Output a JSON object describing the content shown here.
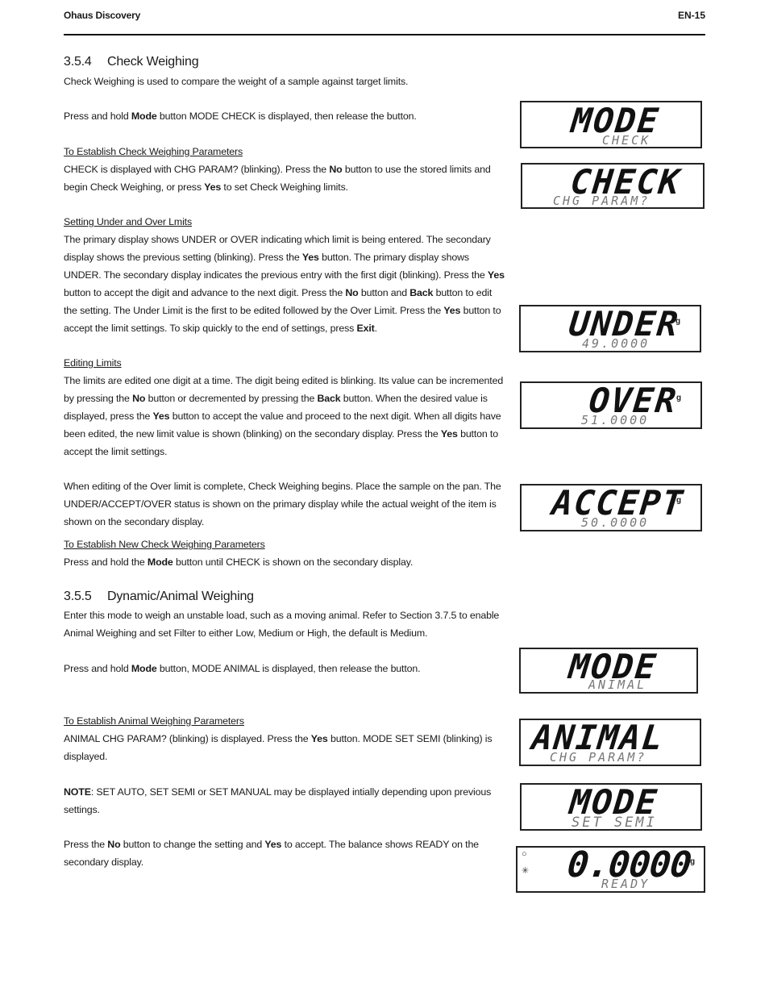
{
  "header": {
    "left": "Ohaus Discovery",
    "right": "EN-15"
  },
  "section_354": {
    "number": "3.5.4",
    "title": "Check Weighing",
    "intro": [
      {
        "t": "Check Weighing is used to compare the weight of a sample against target limits."
      }
    ],
    "press_mode": [
      {
        "t": "Press and hold "
      },
      {
        "t": "Mode",
        "b": true
      },
      {
        "t": " button MODE CHECK is displayed, then release the button."
      }
    ],
    "establish_title": "To Establish Check Weighing Parameters",
    "establish_body": [
      {
        "t": "CHECK is displayed with CHG PARAM? (blinking).  Press the "
      },
      {
        "t": "No",
        "b": true
      },
      {
        "t": " button to use the stored limits and begin Check Weighing, or press "
      },
      {
        "t": "Yes",
        "b": true
      },
      {
        "t": " to set Check Weighing limits."
      }
    ],
    "limits_title": "Setting Under and Over Lmits",
    "limits_body": [
      {
        "t": "The primary display shows UNDER or OVER indicating which limit is being entered.  The secondary display shows the previous setting (blinking).  Press the "
      },
      {
        "t": "Yes",
        "b": true
      },
      {
        "t": " button.  The primary display shows UNDER.  The secondary display indicates the previous entry with the first digit (blinking).  Press the "
      },
      {
        "t": "Yes",
        "b": true
      },
      {
        "t": " button to accept the digit and advance to the next digit.  Press the "
      },
      {
        "t": "No",
        "b": true
      },
      {
        "t": " button and "
      },
      {
        "t": "Back",
        "b": true
      },
      {
        "t": " button to edit the setting.  The Under Limit is the first to be edited followed by the Over Limit.  Press the "
      },
      {
        "t": "Yes",
        "b": true
      },
      {
        "t": " button to accept the limit settings.  To skip quickly to the end of settings, press "
      },
      {
        "t": "Exit",
        "b": true
      },
      {
        "t": "."
      }
    ],
    "editing_title": "Editing Limits",
    "editing_body": [
      {
        "t": "The limits are edited one digit at a time.  The digit being edited is blinking.  Its value can be incremented by pressing the "
      },
      {
        "t": "No",
        "b": true
      },
      {
        "t": " button or decremented by pressing the "
      },
      {
        "t": "Back",
        "b": true
      },
      {
        "t": " button.  When the desired value is displayed, press the "
      },
      {
        "t": "Yes",
        "b": true
      },
      {
        "t": " button to accept the value and proceed to the next digit. When all digits have been edited, the new limit value is shown (blinking) on the secondary display.  Press the "
      },
      {
        "t": "Yes",
        "b": true
      },
      {
        "t": " button to accept the limit settings."
      }
    ],
    "begins_body": [
      {
        "t": "When editing of the Over limit is complete, Check Weighing begins. Place the sample on the pan. The UNDER/ACCEPT/OVER status is shown on the primary display while the actual weight of the item is shown on the secondary display."
      }
    ],
    "new_title": "To Establish New Check Weighing Parameters",
    "new_body": [
      {
        "t": "Press and hold the "
      },
      {
        "t": "Mode",
        "b": true
      },
      {
        "t": " button until CHECK is shown on the secondary display."
      }
    ]
  },
  "section_355": {
    "number": "3.5.5",
    "title": "Dynamic/Animal Weighing",
    "intro": [
      {
        "t": "Enter this mode to weigh an unstable load, such as a moving animal.  Refer to Section 3.7.5 to enable Animal Weighing and set Filter to either Low, Medium or High, the default is Medium."
      }
    ],
    "press_mode": [
      {
        "t": "Press and hold "
      },
      {
        "t": "Mode",
        "b": true
      },
      {
        "t": " button, MODE ANIMAL is displayed, then release the button."
      }
    ],
    "establish_title": "To Establish Animal Weighing Parameters",
    "establish_body": [
      {
        "t": "ANIMAL CHG PARAM? (blinking) is displayed.  Press the "
      },
      {
        "t": "Yes",
        "b": true
      },
      {
        "t": " button. MODE SET SEMI (blinking) is displayed."
      }
    ],
    "note_body": [
      {
        "t": "NOTE",
        "b": true
      },
      {
        "t": ": SET AUTO, SET SEMI or SET MANUAL may be displayed intially depending upon previous settings."
      }
    ],
    "final_body": [
      {
        "t": "Press the "
      },
      {
        "t": "No",
        "b": true
      },
      {
        "t": " button to change the setting and "
      },
      {
        "t": "Yes",
        "b": true
      },
      {
        "t": " to accept.  The balance shows READY on the secondary display."
      }
    ]
  },
  "displays": {
    "mode_check": {
      "primary": "MODE",
      "secondary": "CHECK",
      "unit": ""
    },
    "check_param": {
      "primary": "CHECK",
      "secondary": "CHG PARAM?",
      "unit": ""
    },
    "under": {
      "primary": "UNDER",
      "secondary": "49.0000",
      "unit": "g"
    },
    "over": {
      "primary": "OVER",
      "secondary": "51.0000",
      "unit": "g"
    },
    "accept": {
      "primary": "ACCEPT",
      "secondary": "50.0000",
      "unit": "g"
    },
    "mode_animal": {
      "primary": "MODE",
      "secondary": "ANIMAL",
      "unit": ""
    },
    "animal_param": {
      "primary": "ANIMAL",
      "secondary": "CHG PARAM?",
      "unit": ""
    },
    "mode_semi": {
      "primary": "MODE",
      "secondary": "SET SEMI",
      "unit": ""
    },
    "ready": {
      "primary": "0.0000",
      "secondary": "READY",
      "unit": "g",
      "indicators": [
        "○",
        "✳"
      ]
    }
  }
}
